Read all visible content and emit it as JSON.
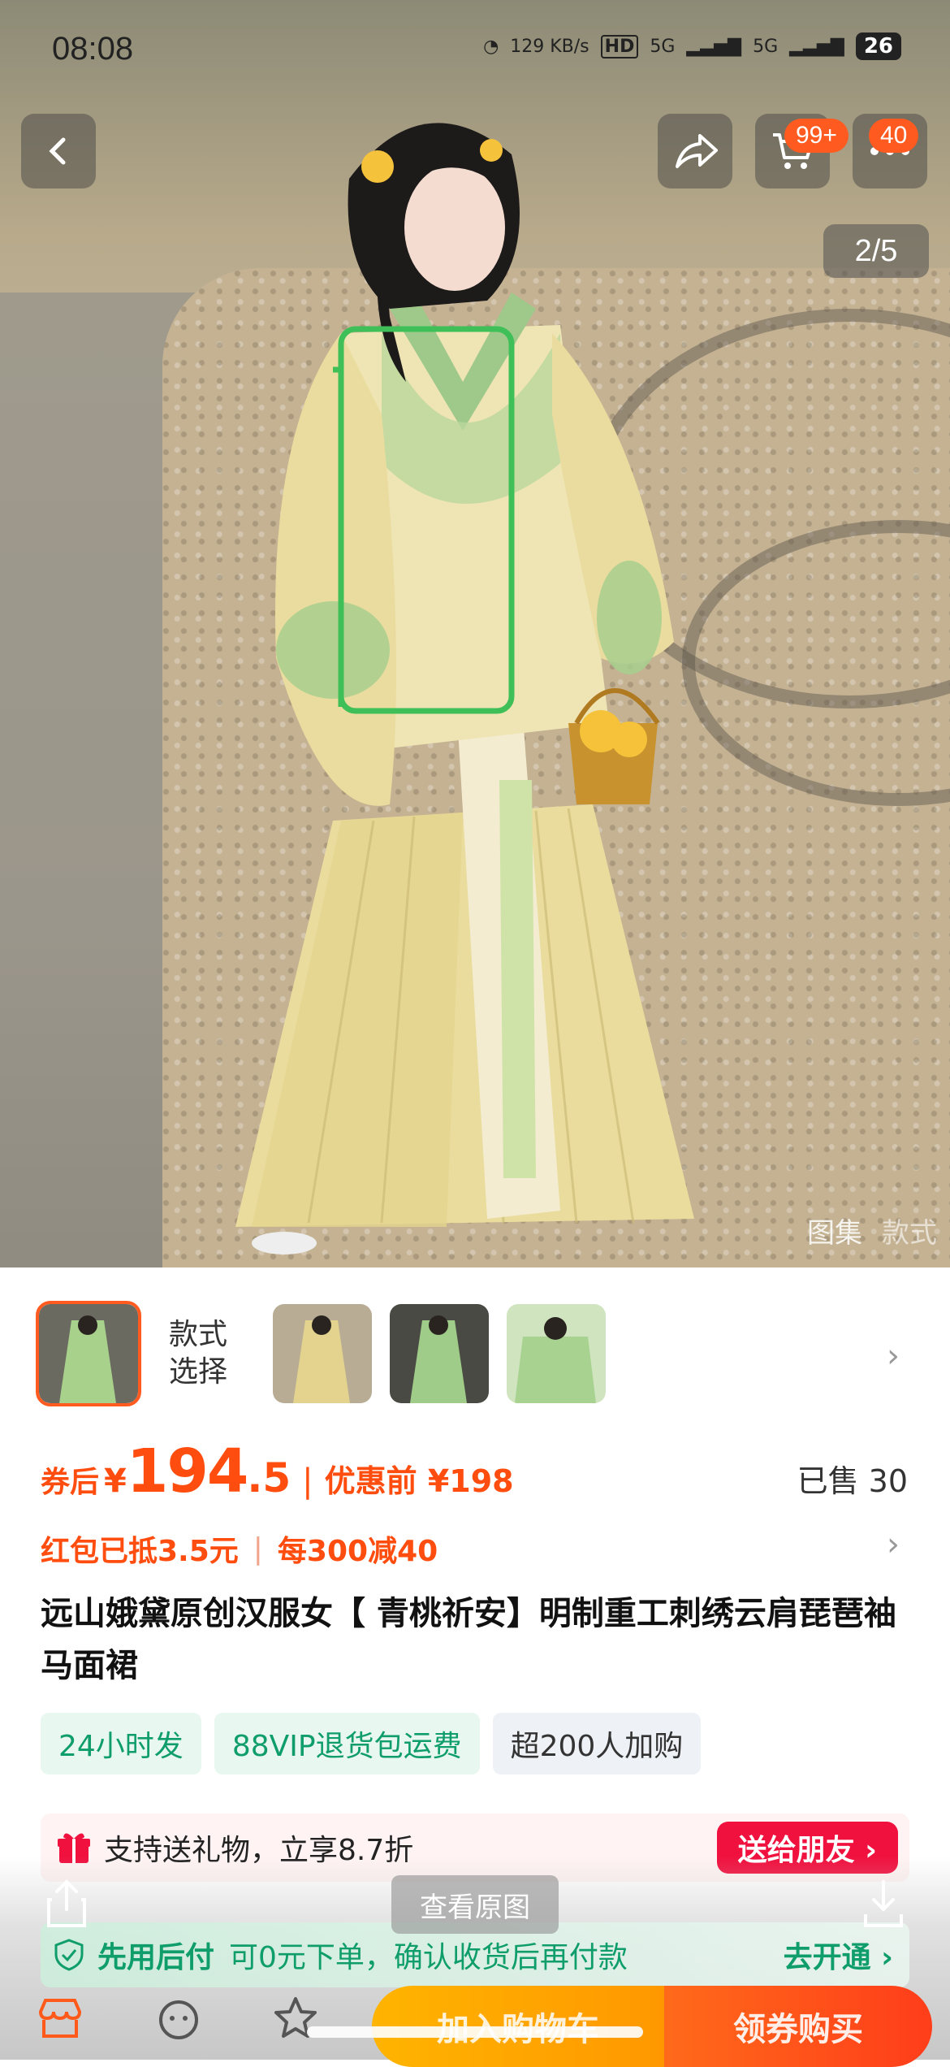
{
  "status": {
    "time": "08:08",
    "net_speed": "129 KB/s",
    "hd": "HD",
    "sim1": "5G",
    "sim2": "5G",
    "battery": "26"
  },
  "header": {
    "back_icon": "chevron-left-icon",
    "share_icon": "share-icon",
    "cart_icon": "cart-icon",
    "cart_badge": "99+",
    "more_badge": "40",
    "image_counter": "2/5"
  },
  "gallery": {
    "tabs": [
      "图集",
      "款式"
    ]
  },
  "variants": {
    "label": "款式\n选择",
    "count": 4,
    "selected_index": 0
  },
  "price": {
    "after_coupon_label": "券后",
    "yen": "¥",
    "integer": "194",
    "decimal": ".5",
    "separator": "|",
    "pre_discount": "优惠前 ¥198",
    "sold": "已售 30"
  },
  "promo": {
    "red_packet": "红包已抵3.5元",
    "separator": "|",
    "discount": "每300减40"
  },
  "title": "远山娥黛原创汉服女【 青桃祈安】明制重工刺绣云肩琵琶袖马面裙",
  "tags": [
    "24小时发",
    "88VIP退货包运费",
    "超200人加购"
  ],
  "gift": {
    "text": "支持送礼物，立享8.7折",
    "button": "送给朋友 ›"
  },
  "paylater": {
    "lead": "先用后付",
    "sub": "可0元下单，确认收货后再付款",
    "action": "去开通 ›"
  },
  "overlay": {
    "view_original": "查看原图"
  },
  "bottom": {
    "add_to_cart": "加入购物车",
    "buy": "领券购买"
  },
  "colors": {
    "accent": "#ff4d0f",
    "green": "#0f9e6b",
    "gift_red": "#f0113f",
    "cta_yellow": "#ffb400",
    "cta_orange": "#ff5a1a"
  }
}
